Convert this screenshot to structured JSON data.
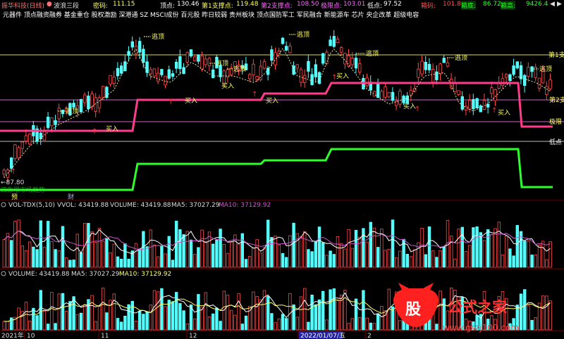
{
  "header": {
    "title": "振华科技(日线)",
    "indicator": "波浪三段",
    "secret_label": "密码:",
    "secret_value": "111.15",
    "top_label": "顶点:",
    "top_value": "130.46",
    "support1_label": "第1支撑点:",
    "support1_value": "119.48",
    "support2_label": "第2支撑点:",
    "support2_value": "108.50",
    "limit_label": "极限点:",
    "limit_value": "103.01",
    "low_label": "低点:",
    "low_value": "97.52",
    "box_code_label": "箱码:",
    "box_code_value": "101.81",
    "box_bottom_label": "箱底:",
    "box_bottom_value": "86.72",
    "box_top_label": "箱高:",
    "box_top_value": "9426.4"
  },
  "tickers": "元器件 顶点融资融券 基金重仓 股权激励 深港通 SZ MSCI成份 百元股 昨日较弱 贵州板块 顶点国防军工 军民融合 新能源车 芯片 央企改革 超级电容",
  "chart": {
    "right_labels": [
      "第1支",
      "第2支",
      "极限",
      "低点"
    ],
    "signal_top": "逃顶",
    "signal_buy": "买入",
    "low_price": "87.80",
    "low_arrow": "←87.80",
    "marker_red": "预",
    "marker_finance": "财",
    "bottom_text": "四象限市场趋势",
    "colors": {
      "up": "#ff4a4a",
      "down": "#54ffff",
      "support": "#ff3c8c",
      "green": "#2cff2c",
      "yellow": "#ffff55"
    }
  },
  "volume_panel1": {
    "label": "VOL-TDX(5,10)",
    "vvol": "VVOL: 43419.88",
    "volume": "VOLUME: 43419.88",
    "ma5": "MA5: 37027.29",
    "ma10": "MA10: 37129.92"
  },
  "volume_panel2": {
    "volume": "VOLUME: 43419.88",
    "ma5": "MA5: 37027.29",
    "ma10": "MA10: 37129.92"
  },
  "xaxis": {
    "year": "2021年",
    "m10": "10",
    "m11": "11",
    "m12": "12",
    "date": "2022/01/07/五",
    "m2": "2"
  },
  "watermark": {
    "logo_char": "股",
    "title": "公式之家",
    "url": "www.gszj100.com"
  }
}
